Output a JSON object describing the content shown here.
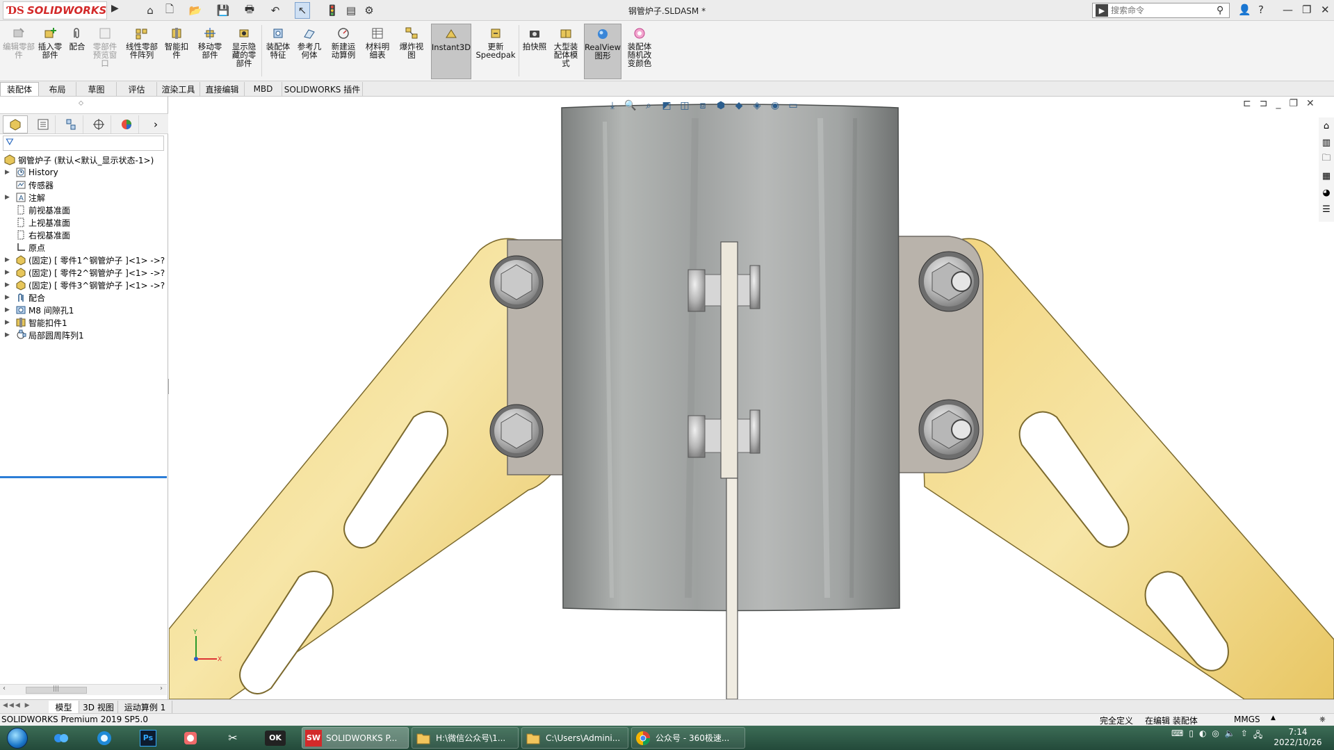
{
  "app": {
    "brand": "SOLIDWORKS",
    "document_title": "钢管炉子.SLDASM *",
    "search_placeholder": "搜索命令"
  },
  "ribbon": {
    "buttons": [
      {
        "label": "编辑零部件",
        "state": "disabled"
      },
      {
        "label": "插入零部件",
        "state": "normal"
      },
      {
        "label": "配合",
        "state": "normal"
      },
      {
        "label": "零部件预览窗口",
        "state": "disabled"
      },
      {
        "label": "线性零部件阵列",
        "state": "normal"
      },
      {
        "label": "智能扣件",
        "state": "normal"
      },
      {
        "label": "移动零部件",
        "state": "normal"
      },
      {
        "label": "显示隐藏的零部件",
        "state": "normal"
      },
      {
        "label": "装配体特征",
        "state": "normal"
      },
      {
        "label": "参考几何体",
        "state": "normal"
      },
      {
        "label": "新建运动算例",
        "state": "normal"
      },
      {
        "label": "材料明细表",
        "state": "normal"
      },
      {
        "label": "爆炸视图",
        "state": "normal"
      },
      {
        "label": "Instant3D",
        "state": "active"
      },
      {
        "label": "更新Speedpak",
        "state": "normal"
      },
      {
        "label": "拍快照",
        "state": "normal"
      },
      {
        "label": "大型装配体模式",
        "state": "normal"
      },
      {
        "label": "RealView图形",
        "state": "active"
      },
      {
        "label": "装配体随机改变颜色",
        "state": "normal"
      }
    ]
  },
  "tabs": [
    "装配体",
    "布局",
    "草图",
    "评估",
    "渲染工具",
    "直接编辑",
    "MBD",
    "SOLIDWORKS 插件"
  ],
  "feature_tree": {
    "root": "钢管炉子  (默认<默认_显示状态-1>)",
    "items": [
      {
        "label": "History",
        "icon": "history-icon",
        "expandable": true
      },
      {
        "label": "传感器",
        "icon": "sensor-icon",
        "expandable": false
      },
      {
        "label": "注解",
        "icon": "annotation-icon",
        "expandable": true
      },
      {
        "label": "前视基准面",
        "icon": "plane-icon",
        "expandable": false
      },
      {
        "label": "上视基准面",
        "icon": "plane-icon",
        "expandable": false
      },
      {
        "label": "右视基准面",
        "icon": "plane-icon",
        "expandable": false
      },
      {
        "label": "原点",
        "icon": "origin-icon",
        "expandable": false
      },
      {
        "label": "(固定) [ 零件1^钢管炉子 ]<1> ->?",
        "icon": "part-icon",
        "expandable": true
      },
      {
        "label": "(固定) [ 零件2^钢管炉子 ]<1> ->?",
        "icon": "part-icon",
        "expandable": true
      },
      {
        "label": "(固定) [ 零件3^钢管炉子 ]<1> ->?",
        "icon": "part-icon",
        "expandable": true
      },
      {
        "label": "配合",
        "icon": "mates-icon",
        "expandable": true
      },
      {
        "label": "M8 间隙孔1",
        "icon": "hole-icon",
        "expandable": true
      },
      {
        "label": "智能扣件1",
        "icon": "fastener-icon",
        "expandable": true
      },
      {
        "label": "局部圆周阵列1",
        "icon": "pattern-icon",
        "expandable": true
      }
    ]
  },
  "model_tabs": [
    "模型",
    "3D 视图",
    "运动算例 1"
  ],
  "status_bar": {
    "product": "SOLIDWORKS Premium 2019 SP5.0",
    "definition": "完全定义",
    "mode": "在编辑 装配体",
    "units": "MMGS"
  },
  "taskbar": {
    "windows": [
      {
        "label": "SOLIDWORKS P...",
        "icon": "solidworks-icon"
      },
      {
        "label": "H:\\微信公众号\\1...",
        "icon": "folder-icon"
      },
      {
        "label": "C:\\Users\\Admini...",
        "icon": "folder-icon"
      },
      {
        "label": "公众号 - 360极速...",
        "icon": "browser-icon"
      }
    ],
    "time": "7:14",
    "date": "2022/10/26"
  },
  "colors": {
    "bracket_yellow": "#f0d480",
    "pipe_gray": "#a7aaa8",
    "plate_gray": "#b9b3ab",
    "selection_blue": "#2c7dd6"
  }
}
